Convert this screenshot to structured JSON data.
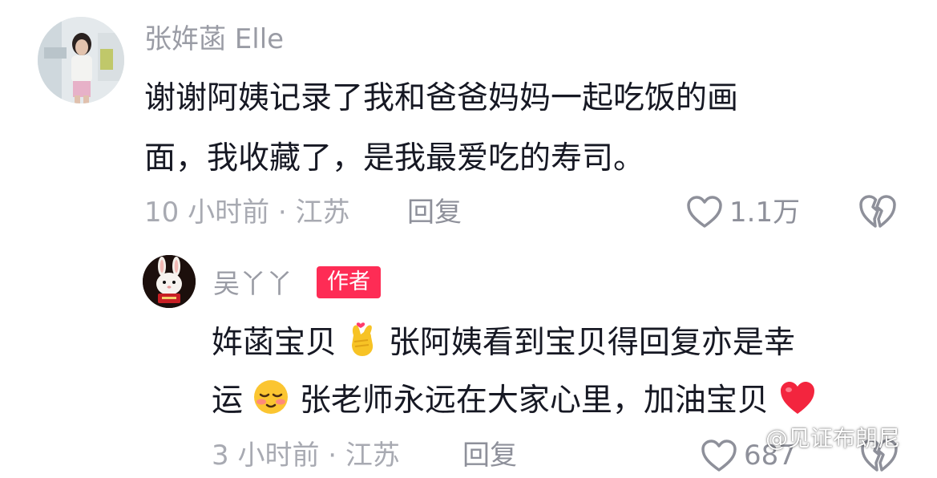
{
  "comment": {
    "username": "张姩菡 Elle",
    "text_line1": "谢谢阿姨记录了我和爸爸妈妈一起吃饭的画",
    "text_line2": "面，我收藏了，是我最爱吃的寿司。",
    "meta": "10 小时前 · 江苏",
    "reply_label": "回复",
    "like_count": "1.1万",
    "avatar_icon": "user-avatar-photo",
    "like_icon": "heart-outline-icon",
    "dislike_icon": "broken-heart-icon"
  },
  "reply": {
    "username": "吴丫丫",
    "author_badge": "作者",
    "author_badge_color": "#fe2c55",
    "text_line1_part1": "姩菡宝贝",
    "text_line1_part2": "张阿姨看到宝贝得回复亦是幸",
    "text_line2_part1": "运",
    "text_line2_part2": "张老师永远在大家心里，加油宝贝",
    "meta": "3 小时前 · 江苏",
    "reply_label": "回复",
    "like_count": "687",
    "avatar_icon": "bunny-avatar",
    "emojis": [
      "finger-heart-emoji",
      "shy-smile-emoji",
      "red-heart-emoji"
    ]
  },
  "watermark": "@见证布朗尼"
}
